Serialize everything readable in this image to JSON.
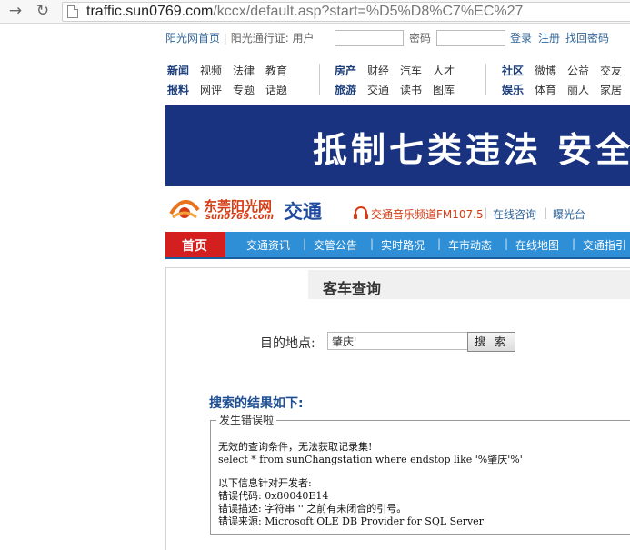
{
  "browser": {
    "url_host": "traffic.sun0769.com",
    "url_path": "/kccx/default.asp?start=%D5%D8%C7%EC%27"
  },
  "login_bar": {
    "home_link": "阳光网首页",
    "passport_label": "阳光通行证: 用户",
    "password_label": "密码",
    "login": "登录",
    "register": "注册",
    "recover": "找回密码"
  },
  "channel_nav": {
    "row1_group1": [
      "新闻",
      "视频",
      "法律",
      "教育"
    ],
    "row2_group1": [
      "报料",
      "网评",
      "专题",
      "话题"
    ],
    "row1_group2": [
      "房产",
      "财经",
      "汽车",
      "人才"
    ],
    "row2_group2": [
      "旅游",
      "交通",
      "读书",
      "图库"
    ],
    "row1_group3": [
      "社区",
      "微博",
      "公益",
      "交友"
    ],
    "row2_group3": [
      "娱乐",
      "体育",
      "丽人",
      "家居"
    ]
  },
  "banner": {
    "text": "抵制七类违法 安全"
  },
  "site_header": {
    "logo_cn": "东莞阳光网",
    "logo_en": "sun0769.com",
    "channel_title": "交通",
    "radio_link": "交通音乐频道FM107.5",
    "consult_link": "在线咨询",
    "exposure_link": "曝光台",
    "separator": "|"
  },
  "menu": {
    "home": "首页",
    "items": [
      "交通资讯",
      "交管公告",
      "实时路况",
      "车市动态",
      "在线地图",
      "交通指引"
    ],
    "separator": "|"
  },
  "content": {
    "title": "客车查询",
    "destination_label": "目的地点:",
    "destination_value": "肇庆'",
    "search_button": "搜 索",
    "results_title": "搜索的结果如下:",
    "error_legend": "发生错误啦",
    "error_lines": [
      "无效的查询条件，无法获取记录集!",
      "select * from sunChangstation where endstop like '%肇庆'%'",
      "以下信息针对开发者:",
      "错误代码: 0x80040E14",
      "错误描述: 字符串 '' 之前有未闭合的引号。",
      "错误来源: Microsoft OLE DB Provider for SQL Server"
    ]
  },
  "colors": {
    "banner_bg": "#193380",
    "menu_bg": "#2e8fd6",
    "menu_home_bg": "#d41f1f",
    "brand_orange": "#d63b13",
    "channel_blue": "#1f4aa0"
  }
}
